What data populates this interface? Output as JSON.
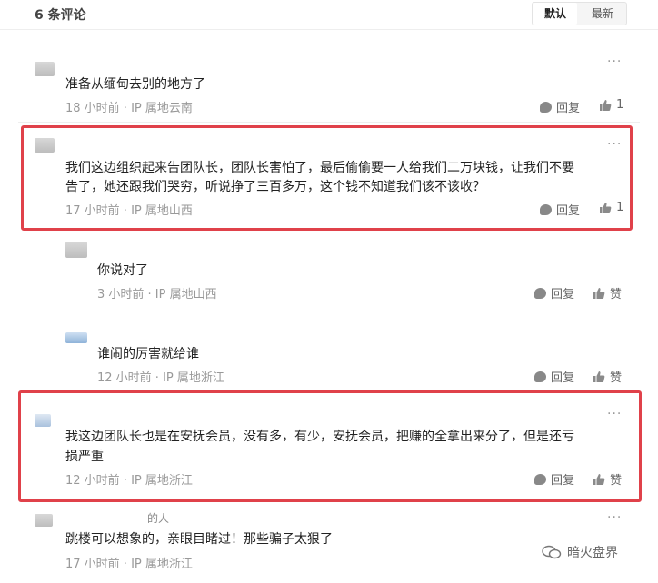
{
  "header": {
    "comment_count": "6 条评论",
    "sort_default": "默认",
    "sort_latest": "最新"
  },
  "comments": [
    {
      "username": "",
      "text": "准备从缅甸去别的地方了",
      "meta": "18 小时前 · IP 属地云南",
      "reply_label": "回复",
      "like_label": "1"
    },
    {
      "username": "",
      "text_line1": "我们这边组织起来告团队长，团队长害怕了，最后偷偷要一人给我们二万块钱，让我们不要",
      "text_line2": "告了，她还跟我们哭穷，听说挣了三百多万，这个钱不知道我们该不该收？",
      "meta": "17 小时前 · IP 属地山西",
      "reply_label": "回复",
      "like_label": "1"
    },
    {
      "username": "",
      "text": "你说对了",
      "meta": "3 小时前 · IP 属地山西",
      "reply_label": "回复",
      "like_label": "赞"
    },
    {
      "username": "",
      "text": "谁闹的厉害就给谁",
      "meta": "12 小时前 · IP 属地浙江",
      "reply_label": "回复",
      "like_label": "赞"
    },
    {
      "username": "",
      "text_line1": "我这边团队长也是在安抚会员，没有多，有少，安抚会员，把赚的全拿出来分了，但是还亏",
      "text_line2": "损严重",
      "meta": "12 小时前 · IP 属地浙江",
      "reply_label": "回复",
      "like_label": "赞"
    },
    {
      "username": "的人",
      "text": "跳楼可以想象的，亲眼目睹过！那些骗子太狠了",
      "meta": "17 小时前 · IP 属地浙江",
      "reply_label": "回复",
      "like_label": "赞"
    }
  ],
  "watermark": {
    "text": "暗火盘界"
  }
}
